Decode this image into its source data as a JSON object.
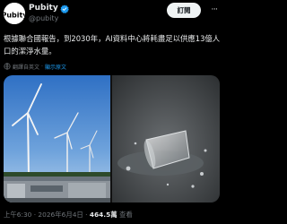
{
  "author": {
    "display_name": "Pubity",
    "handle": "@pubity",
    "avatar_icon": "pubity-logo",
    "verified_icon": "verified-badge-icon"
  },
  "actions": {
    "follow_label": "訂閱",
    "more_label": "···"
  },
  "post": {
    "text": "根據聯合國報告，到2030年，AI資料中心將耗盡足以供應13億人口的潔淨水量。",
    "translation": {
      "language_label": "翻譯自英文",
      "separator": "·",
      "show_original_label": "顯示原文"
    }
  },
  "media": {
    "left_image": "wind-turbines-and-data-center",
    "right_image": "spilled-glass-of-water"
  },
  "meta": {
    "timestamp": "上午6:30 · 2026年6月4日 · ",
    "views_count": "464.5萬",
    "views_label": " 查看"
  },
  "colors": {
    "background": "#000000",
    "text": "#e7e9ea",
    "muted": "#71767b",
    "link": "#1d9bf0",
    "verified": "#1d9bf0",
    "button_bg": "#eff3f4"
  }
}
